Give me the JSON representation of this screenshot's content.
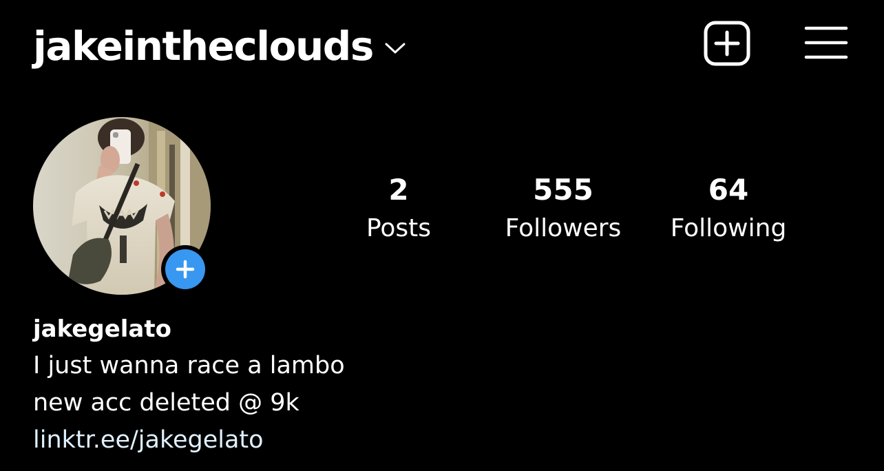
{
  "header": {
    "username": "jakeintheclouds",
    "chevron_icon": "chevron-down-icon",
    "new_post_icon": "plus-square-icon",
    "menu_icon": "hamburger-menu-icon"
  },
  "profile": {
    "avatar_icon": "profile-photo",
    "add_story_icon": "plus-circle-icon",
    "add_story_color": "#3897f0"
  },
  "stats": [
    {
      "value": "2",
      "label": "Posts"
    },
    {
      "value": "555",
      "label": "Followers"
    },
    {
      "value": "64",
      "label": "Following"
    }
  ],
  "bio": {
    "name": "jakegelato",
    "lines": [
      "I just wanna race a lambo",
      "new acc deleted @ 9k"
    ],
    "link": "linktr.ee/jakegelato"
  },
  "colors": {
    "background": "#000000",
    "text": "#ffffff",
    "link": "#e0f1ff",
    "accent": "#3897f0"
  }
}
